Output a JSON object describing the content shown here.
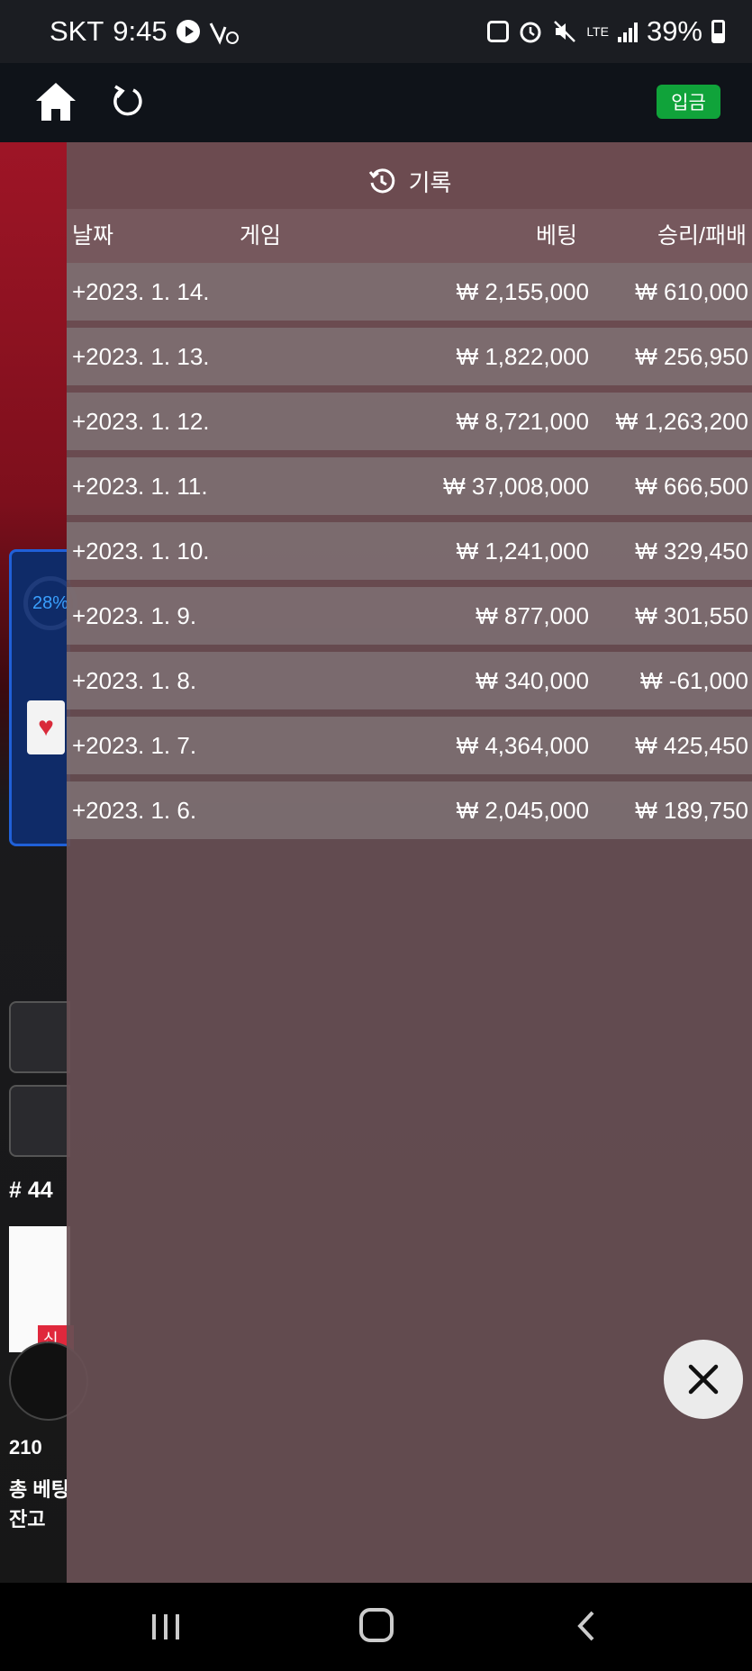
{
  "status_bar": {
    "carrier": "SKT",
    "time": "9:45",
    "battery": "39%",
    "network": "LTE"
  },
  "appbar": {
    "deposit_label": "입금"
  },
  "background": {
    "percent": "28%",
    "round": "# 44",
    "new_badge": "신",
    "stat_line": "210",
    "total_bet_label": "총 베팅",
    "balance_label": "잔고"
  },
  "modal": {
    "title": "기록",
    "columns": {
      "date": "날짜",
      "game": "게임",
      "bet": "베팅",
      "win_loss": "승리/패배"
    },
    "rows": [
      {
        "date": "+2023. 1. 14.",
        "bet": "₩ 2,155,000",
        "win_loss": "₩ 610,000"
      },
      {
        "date": "+2023. 1. 13.",
        "bet": "₩ 1,822,000",
        "win_loss": "₩ 256,950"
      },
      {
        "date": "+2023. 1. 12.",
        "bet": "₩ 8,721,000",
        "win_loss": "₩ 1,263,200"
      },
      {
        "date": "+2023. 1. 11.",
        "bet": "₩ 37,008,000",
        "win_loss": "₩ 666,500"
      },
      {
        "date": "+2023. 1. 10.",
        "bet": "₩ 1,241,000",
        "win_loss": "₩ 329,450"
      },
      {
        "date": "+2023. 1. 9.",
        "bet": "₩ 877,000",
        "win_loss": "₩ 301,550"
      },
      {
        "date": "+2023. 1. 8.",
        "bet": "₩ 340,000",
        "win_loss": "₩ -61,000"
      },
      {
        "date": "+2023. 1. 7.",
        "bet": "₩ 4,364,000",
        "win_loss": "₩ 425,450"
      },
      {
        "date": "+2023. 1. 6.",
        "bet": "₩ 2,045,000",
        "win_loss": "₩ 189,750"
      }
    ]
  },
  "colors": {
    "deposit_green": "#10a33a",
    "modal_bg": "#685054",
    "header_bg": "#0f1319"
  }
}
